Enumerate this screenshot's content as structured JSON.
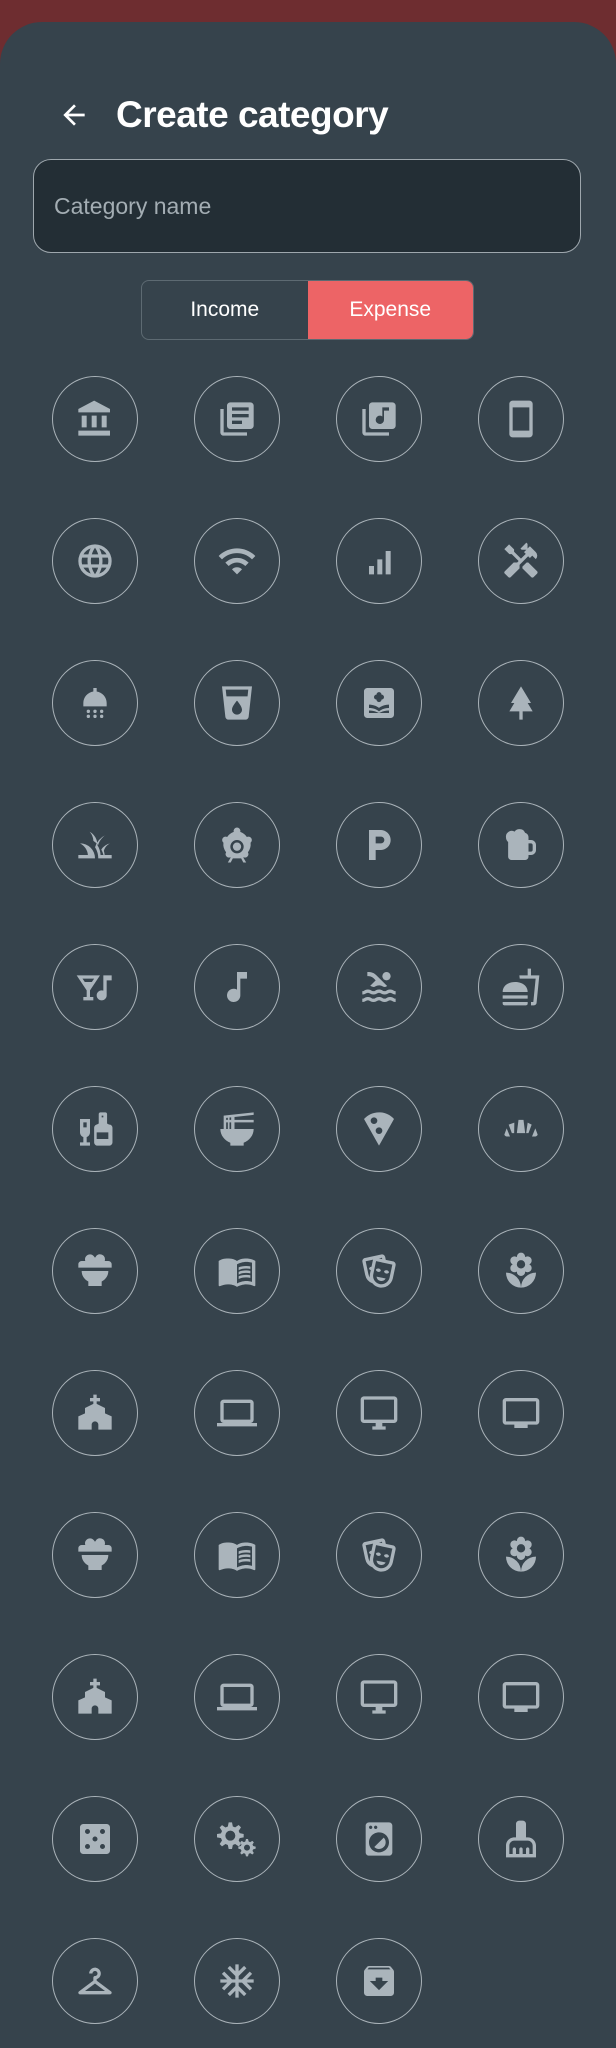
{
  "header": {
    "title": "Create category",
    "back_icon": "arrow-left-icon"
  },
  "name_input": {
    "placeholder": "Category name",
    "value": ""
  },
  "type_toggle": {
    "options": [
      "Income",
      "Expense"
    ],
    "selected": "Expense"
  },
  "colors": {
    "backdrop": "#6e2d30",
    "sheet": "#36434c",
    "accent": "#ed6466",
    "icon": "#aab4bb"
  },
  "icons": [
    "bank-icon",
    "newspaper-icon",
    "music-library-icon",
    "phone-icon",
    "globe-icon",
    "wifi-icon",
    "signal-bars-icon",
    "tools-icon",
    "shower-icon",
    "water-glass-icon",
    "flower-box-icon",
    "tree-icon",
    "grass-icon",
    "ferris-wheel-icon",
    "parking-icon",
    "beer-icon",
    "nightlife-icon",
    "music-note-icon",
    "swimming-icon",
    "fast-food-icon",
    "liquor-icon",
    "ramen-icon",
    "pizza-icon",
    "bakery-icon",
    "rice-bowl-icon",
    "book-icon",
    "theater-masks-icon",
    "local-florist-icon",
    "house-icon",
    "laptop-icon",
    "desktop-icon",
    "tv-icon",
    "rice-bowl-icon",
    "book-icon",
    "theater-masks-icon",
    "local-florist-icon",
    "house-icon",
    "laptop-icon",
    "desktop-icon",
    "tv-icon",
    "dice-icon",
    "gears-icon",
    "washing-machine-icon",
    "cleaning-brush-icon",
    "hanger-icon",
    "snowflake-icon",
    "archive-box-icon"
  ]
}
